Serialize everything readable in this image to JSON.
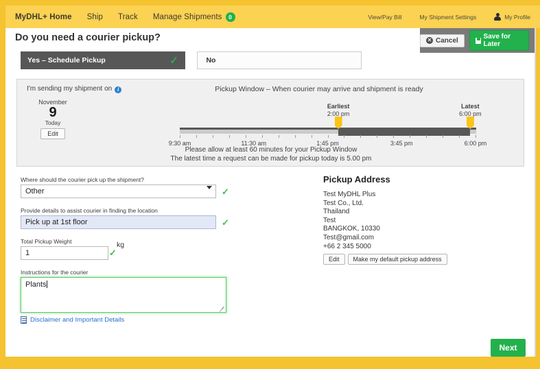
{
  "nav": {
    "items": [
      {
        "label": "MyDHL+ Home",
        "badge": null
      },
      {
        "label": "Ship",
        "badge": null
      },
      {
        "label": "Track",
        "badge": null
      },
      {
        "label": "Manage Shipments",
        "badge": "0"
      }
    ],
    "right": {
      "view_pay_bill": "View/Pay Bill",
      "shipment_settings": "My Shipment Settings",
      "profile": "My Profile"
    }
  },
  "header": {
    "title": "Do you need a courier pickup?",
    "cancel_label": "Cancel",
    "save_label": "Save for Later"
  },
  "toggle": {
    "yes_label": "Yes – Schedule Pickup",
    "no_label": "No",
    "selected": "yes"
  },
  "panel": {
    "sending_label": "I'm sending my shipment on",
    "date": {
      "month": "November",
      "day": "9",
      "today": "Today",
      "edit_label": "Edit"
    },
    "window_title": "Pickup Window – When courier may arrive and shipment is ready",
    "note_line1": "Please allow at least 60 minutes for your Pickup Window",
    "note_line2": "The latest time a request can be made for pickup today is 5.00 pm"
  },
  "slider": {
    "earliest_label": "Earliest",
    "earliest_time": "2:00 pm",
    "latest_label": "Latest",
    "latest_time": "6:00 pm",
    "scale": [
      "9:30 am",
      "11:30 am",
      "1:45 pm",
      "3:45 pm",
      "6:00 pm"
    ],
    "earliest_pct": 53.5,
    "latest_pct": 98.0,
    "tick_count": 19
  },
  "form": {
    "where_label": "Where should the courier pick up the shipment?",
    "where_value": "Other",
    "details_label": "Provide details to assist courier in finding the location",
    "details_value": "Pick up at 1st floor",
    "weight_label": "Total Pickup Weight",
    "weight_value": "1",
    "weight_unit": "kg",
    "instructions_label": "Instructions for the courier",
    "instructions_value": "Plants",
    "disclaimer_label": "Disclaimer and Important Details",
    "valid_mark": "✓"
  },
  "address": {
    "heading": "Pickup Address",
    "lines": [
      "Test MyDHL Plus",
      "Test Co., Ltd.",
      "Thailand",
      "Test",
      "BANGKOK, 10330",
      "Test@gmail.com",
      "+66 2 345 5000"
    ],
    "edit_label": "Edit",
    "default_label": "Make my default pickup address"
  },
  "footer": {
    "next_label": "Next"
  },
  "colors": {
    "brand_yellow": "#f5c230",
    "nav_yellow": "#fbd251",
    "green": "#22b14c",
    "handle_yellow": "#fbc417",
    "dark_grey": "#575757"
  }
}
